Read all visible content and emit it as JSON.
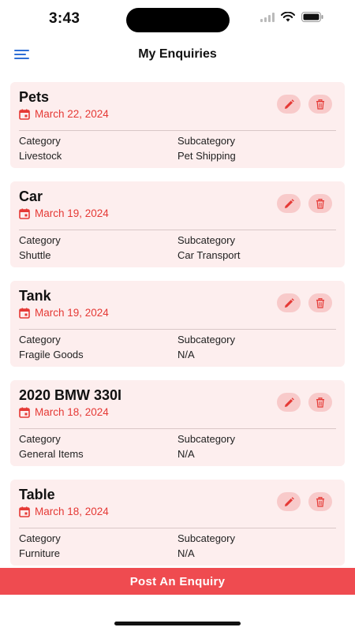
{
  "status_bar": {
    "time": "3:43"
  },
  "nav": {
    "title": "My Enquiries"
  },
  "enquiries": [
    {
      "title": "Pets",
      "date": "March 22, 2024",
      "category_label": "Category",
      "category": "Livestock",
      "subcategory_label": "Subcategory",
      "subcategory": "Pet Shipping"
    },
    {
      "title": "Car",
      "date": "March 19, 2024",
      "category_label": "Category",
      "category": "Shuttle",
      "subcategory_label": "Subcategory",
      "subcategory": "Car Transport"
    },
    {
      "title": "Tank",
      "date": "March 19, 2024",
      "category_label": "Category",
      "category": "Fragile Goods",
      "subcategory_label": "Subcategory",
      "subcategory": "N/A"
    },
    {
      "title": "2020 BMW 330I",
      "date": "March 18, 2024",
      "category_label": "Category",
      "category": "General Items",
      "subcategory_label": "Subcategory",
      "subcategory": "N/A"
    },
    {
      "title": "Table",
      "date": "March 18, 2024",
      "category_label": "Category",
      "category": "Furniture",
      "subcategory_label": "Subcategory",
      "subcategory": "N/A"
    }
  ],
  "post_button": {
    "label": "Post An Enquiry"
  },
  "icons": {
    "menu": "hamburger-menu-icon",
    "date": "calendar-icon",
    "edit": "pencil-icon",
    "delete": "trash-icon"
  },
  "colors": {
    "accent": "#ef4b50",
    "date_text": "#e53935",
    "card_bg": "#fdeeee",
    "action_bg": "#f8caca",
    "menu_icon": "#2f6fd6"
  }
}
